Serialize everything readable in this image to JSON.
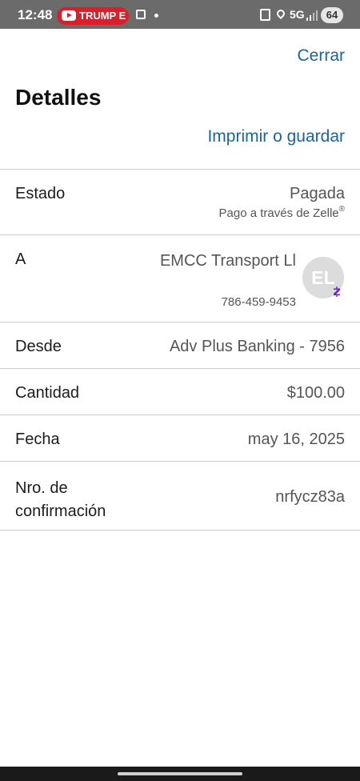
{
  "status_bar": {
    "time": "12:48",
    "notification": "TRUMP E",
    "network": "5G",
    "battery": "64"
  },
  "header": {
    "close_label": "Cerrar",
    "title": "Detalles",
    "print_label": "Imprimir o guardar"
  },
  "details": {
    "status": {
      "label": "Estado",
      "value": "Pagada",
      "sub": "Pago a través de Zelle",
      "sub_mark": "®"
    },
    "recipient": {
      "label": "A",
      "name": "EMCC Transport Ll",
      "phone": "786-459-9453",
      "initials": "EL"
    },
    "from": {
      "label": "Desde",
      "value": "Adv Plus Banking - 7956"
    },
    "amount": {
      "label": "Cantidad",
      "value": "$100.00"
    },
    "date": {
      "label": "Fecha",
      "value": "may 16, 2025"
    },
    "confirmation": {
      "label": "Nro. de confirmación",
      "value": "nrfycz83a"
    }
  },
  "colors": {
    "link": "#1a64a6",
    "zelle": "#6d1ed4",
    "status_bar": "#6b6b6b"
  }
}
